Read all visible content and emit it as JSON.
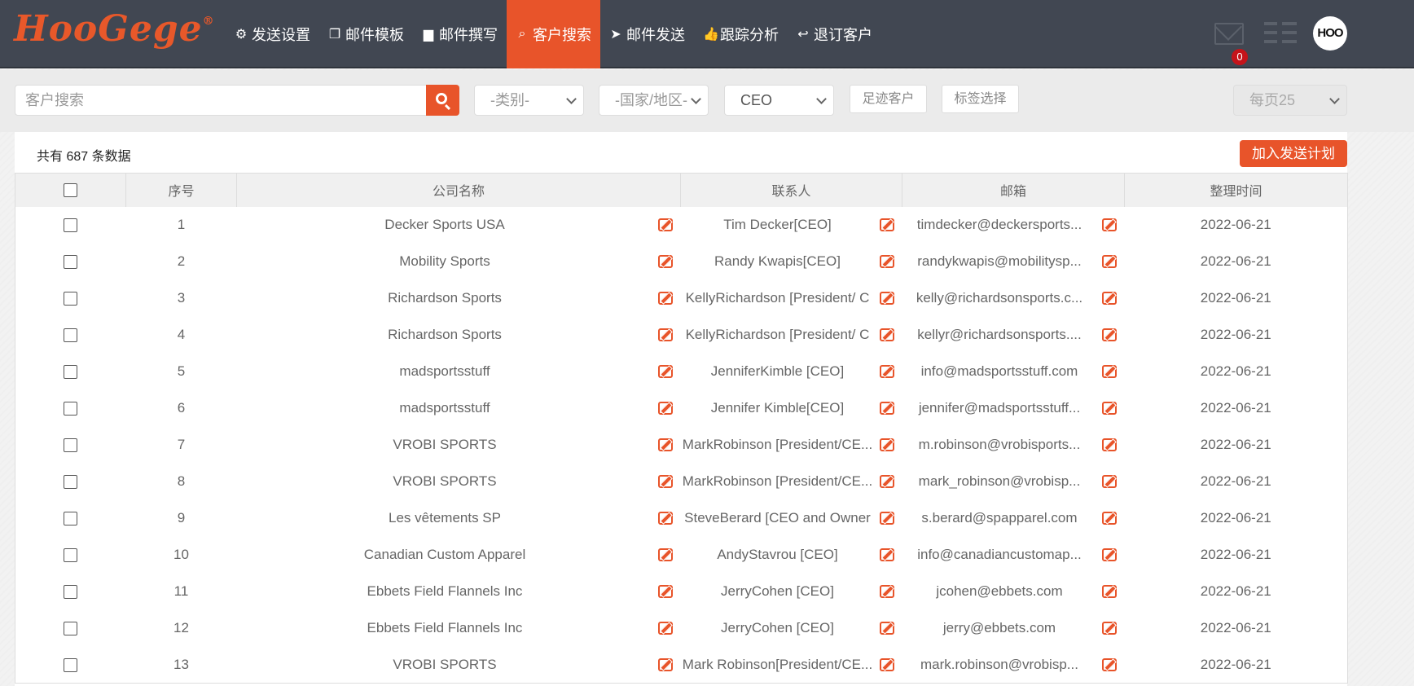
{
  "brand": {
    "logo": "HooGege",
    "reg": "®"
  },
  "nav": {
    "items": [
      {
        "label": "发送设置",
        "icon": "gear-icon",
        "glyph": "⚙",
        "active": false
      },
      {
        "label": "邮件模板",
        "icon": "copy-icon",
        "glyph": "❐",
        "active": false
      },
      {
        "label": "邮件撰写",
        "icon": "file-icon",
        "glyph": "▆",
        "active": false
      },
      {
        "label": "客户搜索",
        "icon": "search-icon",
        "glyph": "⌕",
        "active": true
      },
      {
        "label": "邮件发送",
        "icon": "paper-plane-icon",
        "glyph": "➤",
        "active": false
      },
      {
        "label": "跟踪分析",
        "icon": "thumbs-up-icon",
        "glyph": "👍",
        "active": false
      },
      {
        "label": "退订客户",
        "icon": "reply-icon",
        "glyph": "↩",
        "active": false
      }
    ],
    "mail_badge": "0",
    "avatar_text": "HOO"
  },
  "filters": {
    "search_placeholder": "客户搜索",
    "category": "-类别-",
    "country": "-国家/地区-",
    "title": "CEO",
    "footprint_button": "足迹客户",
    "tag_button": "标签选择",
    "per_page": "每页25"
  },
  "summary": {
    "total_text": "共有 687 条数据",
    "add_plan_button": "加入发送计划"
  },
  "table": {
    "headers": [
      "序号",
      "公司名称",
      "联系人",
      "邮箱",
      "整理时间"
    ],
    "rows": [
      {
        "no": "1",
        "company": "Decker Sports USA",
        "contact": "Tim Decker[CEO]",
        "email": "timdecker@deckersports...",
        "date": "2022-06-21"
      },
      {
        "no": "2",
        "company": "Mobility Sports",
        "contact": "Randy Kwapis[CEO]",
        "email": "randykwapis@mobilitysp...",
        "date": "2022-06-21"
      },
      {
        "no": "3",
        "company": "Richardson Sports",
        "contact": "KellyRichardson [President/ C",
        "email": "kelly@richardsonsports.c...",
        "date": "2022-06-21"
      },
      {
        "no": "4",
        "company": "Richardson Sports",
        "contact": "KellyRichardson [President/ C",
        "email": "kellyr@richardsonsports....",
        "date": "2022-06-21"
      },
      {
        "no": "5",
        "company": "madsportsstuff",
        "contact": "JenniferKimble [CEO]",
        "email": "info@madsportsstuff.com",
        "date": "2022-06-21"
      },
      {
        "no": "6",
        "company": "madsportsstuff",
        "contact": "Jennifer Kimble[CEO]",
        "email": "jennifer@madsportsstuff...",
        "date": "2022-06-21"
      },
      {
        "no": "7",
        "company": "VROBI SPORTS",
        "contact": "MarkRobinson [President/CE...",
        "email": "m.robinson@vrobisports...",
        "date": "2022-06-21"
      },
      {
        "no": "8",
        "company": "VROBI SPORTS",
        "contact": "MarkRobinson [President/CE...",
        "email": "mark_robinson@vrobisp...",
        "date": "2022-06-21"
      },
      {
        "no": "9",
        "company": "Les vêtements SP",
        "contact": "SteveBerard [CEO and Owner",
        "email": "s.berard@spapparel.com",
        "date": "2022-06-21"
      },
      {
        "no": "10",
        "company": "Canadian Custom Apparel",
        "contact": "AndyStavrou [CEO]",
        "email": "info@canadiancustomap...",
        "date": "2022-06-21"
      },
      {
        "no": "11",
        "company": "Ebbets Field Flannels Inc",
        "contact": "JerryCohen [CEO]",
        "email": "jcohen@ebbets.com",
        "date": "2022-06-21"
      },
      {
        "no": "12",
        "company": "Ebbets Field Flannels Inc",
        "contact": "JerryCohen [CEO]",
        "email": "jerry@ebbets.com",
        "date": "2022-06-21"
      },
      {
        "no": "13",
        "company": "VROBI SPORTS",
        "contact": "Mark Robinson[President/CE...",
        "email": "mark.robinson@vrobisp...",
        "date": "2022-06-21"
      }
    ]
  },
  "colors": {
    "accent": "#e8542a",
    "nav_bg": "#414752",
    "badge": "#c5141a"
  }
}
